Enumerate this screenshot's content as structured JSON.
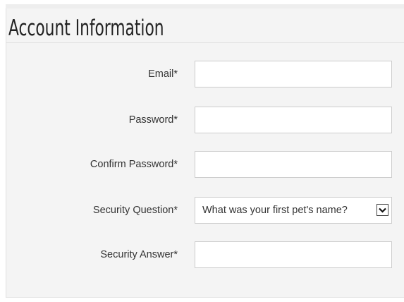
{
  "section": {
    "title": "Account Information"
  },
  "form": {
    "email": {
      "label": "Email*",
      "value": "",
      "placeholder": ""
    },
    "password": {
      "label": "Password*",
      "value": "",
      "placeholder": ""
    },
    "confirm_password": {
      "label": "Confirm Password*",
      "value": "",
      "placeholder": ""
    },
    "security_question": {
      "label": "Security Question*",
      "selected": "What was your first pet's name?",
      "icon": "chevron-down-icon"
    },
    "security_answer": {
      "label": "Security Answer*",
      "value": "",
      "placeholder": ""
    }
  }
}
